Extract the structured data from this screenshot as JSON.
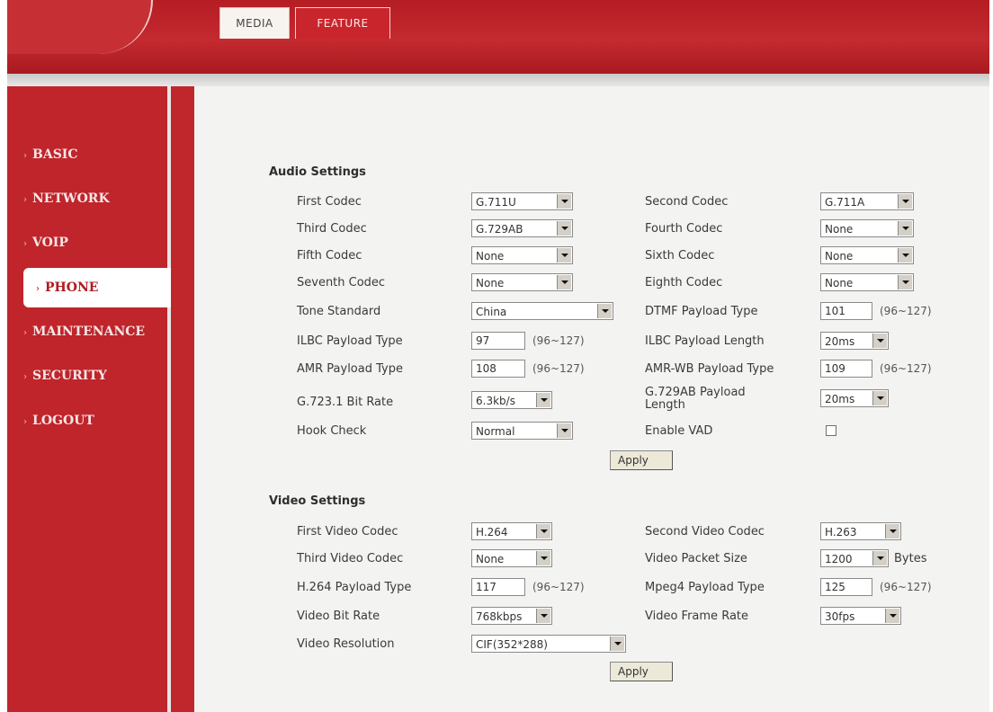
{
  "tabs": {
    "media": "MEDIA",
    "feature": "FEATURE"
  },
  "nav": [
    {
      "id": "basic",
      "label": "BASIC"
    },
    {
      "id": "network",
      "label": "NETWORK"
    },
    {
      "id": "voip",
      "label": "VOIP"
    },
    {
      "id": "phone",
      "label": "PHONE",
      "active": true
    },
    {
      "id": "maintenance",
      "label": "MAINTENANCE"
    },
    {
      "id": "security",
      "label": "SECURITY"
    },
    {
      "id": "logout",
      "label": "LOGOUT"
    }
  ],
  "audio": {
    "title": "Audio Settings",
    "first_codec": {
      "label": "First Codec",
      "value": "G.711U"
    },
    "second_codec": {
      "label": "Second Codec",
      "value": "G.711A"
    },
    "third_codec": {
      "label": "Third Codec",
      "value": "G.729AB"
    },
    "fourth_codec": {
      "label": "Fourth Codec",
      "value": "None"
    },
    "fifth_codec": {
      "label": "Fifth Codec",
      "value": "None"
    },
    "sixth_codec": {
      "label": "Sixth Codec",
      "value": "None"
    },
    "seventh_codec": {
      "label": "Seventh Codec",
      "value": "None"
    },
    "eighth_codec": {
      "label": "Eighth Codec",
      "value": "None"
    },
    "tone_standard": {
      "label": "Tone Standard",
      "value": "China"
    },
    "dtmf_payload": {
      "label": "DTMF Payload Type",
      "value": "101",
      "range": "(96~127)"
    },
    "ilbc_payload": {
      "label": "ILBC Payload Type",
      "value": "97",
      "range": "(96~127)"
    },
    "ilbc_length": {
      "label": "ILBC Payload Length",
      "value": "20ms"
    },
    "amr_payload": {
      "label": "AMR Payload Type",
      "value": "108",
      "range": "(96~127)"
    },
    "amrwb_payload": {
      "label": "AMR-WB Payload Type",
      "value": "109",
      "range": "(96~127)"
    },
    "g7231_bitrate": {
      "label": "G.723.1 Bit Rate",
      "value": "6.3kb/s"
    },
    "g729ab_length": {
      "label_line1": "G.729AB Payload",
      "label_line2": "Length",
      "value": "20ms"
    },
    "hook_check": {
      "label": "Hook Check",
      "value": "Normal"
    },
    "enable_vad": {
      "label": "Enable VAD",
      "checked": false
    },
    "apply": "Apply"
  },
  "video": {
    "title": "Video Settings",
    "first_codec": {
      "label": "First Video Codec",
      "value": "H.264"
    },
    "second_codec": {
      "label": "Second Video Codec",
      "value": "H.263"
    },
    "third_codec": {
      "label": "Third Video Codec",
      "value": "None"
    },
    "packet_size": {
      "label": "Video Packet Size",
      "value": "1200",
      "unit": "Bytes"
    },
    "h264_payload": {
      "label": "H.264 Payload Type",
      "value": "117",
      "range": "(96~127)"
    },
    "mpeg4_payload": {
      "label": "Mpeg4 Payload Type",
      "value": "125",
      "range": "(96~127)"
    },
    "bit_rate": {
      "label": "Video Bit Rate",
      "value": "768kbps"
    },
    "frame_rate": {
      "label": "Video Frame Rate",
      "value": "30fps"
    },
    "resolution": {
      "label": "Video Resolution",
      "value": "CIF(352*288)"
    },
    "apply": "Apply"
  }
}
